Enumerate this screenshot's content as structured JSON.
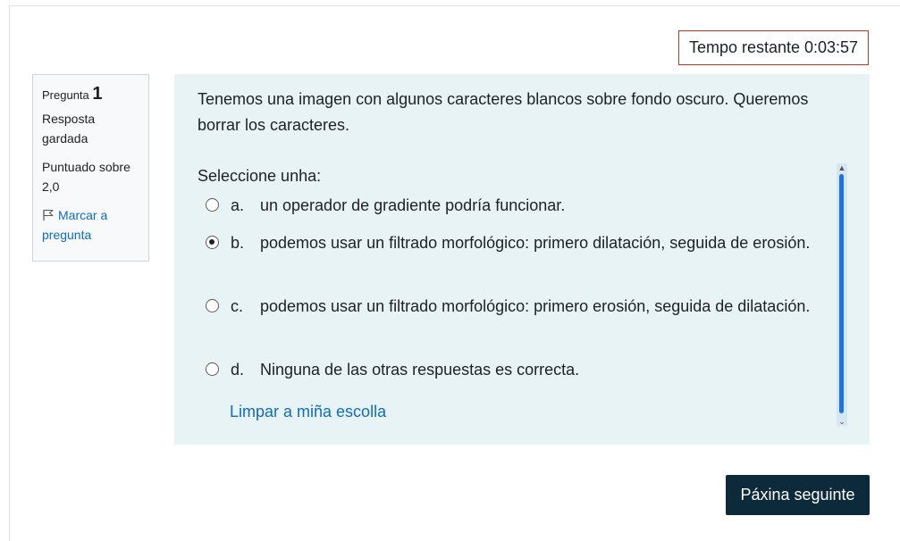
{
  "timer": {
    "label": "Tempo restante 0:03:57"
  },
  "question_info": {
    "label": "Pregunta",
    "number": "1",
    "state": "Resposta gardada",
    "grade": "Puntuado sobre 2,0",
    "flag_label": "Marcar a pregunta",
    "flag_icon": "flag-icon"
  },
  "question": {
    "text": "Tenemos una imagen con algunos caracteres blancos sobre fondo oscuro. Queremos borrar los caracteres.",
    "prompt": "Seleccione unha:",
    "options": [
      {
        "letter": "a.",
        "text": "un operador de gradiente podría funcionar.",
        "selected": false
      },
      {
        "letter": "b.",
        "text": "podemos usar un filtrado morfológico: primero dilatación, seguida de erosión.",
        "selected": true
      },
      {
        "letter": "c.",
        "text": "podemos usar un filtrado morfológico: primero erosión, seguida de dilatación.",
        "selected": false
      },
      {
        "letter": "d.",
        "text": "Ninguna de las otras respuestas es correcta.",
        "selected": false
      }
    ],
    "clear_label": "Limpar a miña escolla"
  },
  "navigation": {
    "next_label": "Páxina seguinte"
  },
  "colors": {
    "timer_border": "#ca3120",
    "content_bg": "#e7f3f5",
    "link": "#0f6cbf",
    "button_bg": "#0d2a3b"
  }
}
